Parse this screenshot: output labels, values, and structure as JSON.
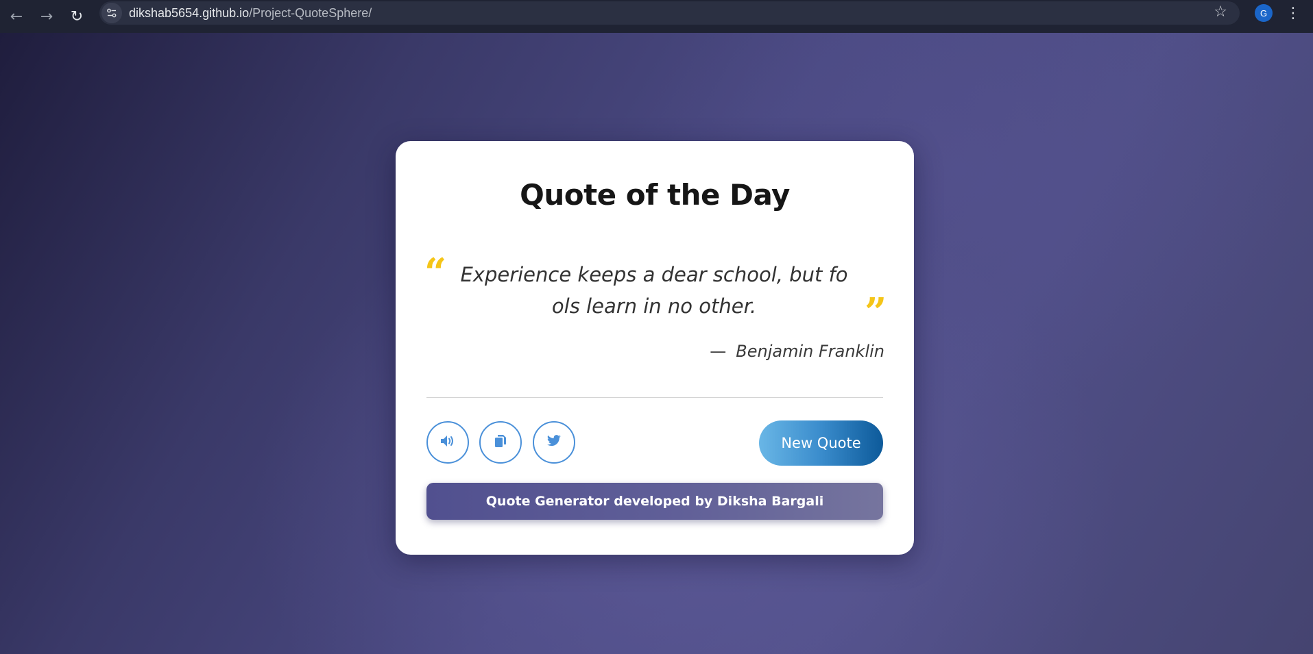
{
  "browser": {
    "url_host": "dikshab5654.github.io",
    "url_path": "/Project-QuoteSphere/",
    "profile_initial": "G",
    "icons": [
      "back-arrow-icon",
      "forward-arrow-icon",
      "reload-icon",
      "site-info-icon",
      "bookmark-star-icon",
      "kebab-menu-icon"
    ]
  },
  "card": {
    "title": "Quote of the Day",
    "quote": "Experience keeps a dear school, but fools learn in no other.",
    "author_dash": "—",
    "author": "Benjamin Franklin",
    "new_quote_label": "New Quote",
    "footer": "Quote Generator developed by Diksha Bargali",
    "action_icons": [
      "speaker-icon",
      "copy-icon",
      "twitter-icon"
    ]
  },
  "colors": {
    "accent_quote_marks": "#f5c518",
    "icon_button_border": "#4a90d9",
    "new_quote_gradient_start": "#69b6e6",
    "new_quote_gradient_end": "#0d5a9a",
    "footer_gradient_start": "#51508f",
    "footer_gradient_end": "#76759e"
  }
}
